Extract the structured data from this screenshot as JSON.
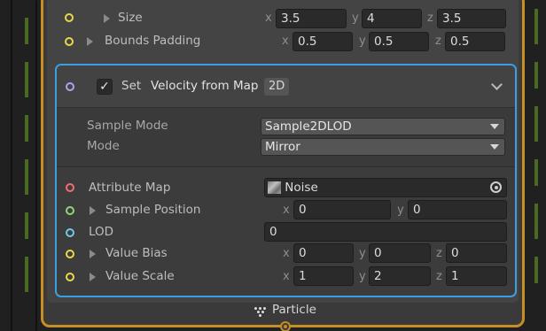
{
  "colors": {
    "selection_border": "#3aa0e6",
    "context_border": "#c58f25",
    "port_yellow": "#e8d84a",
    "port_purple": "#b89cf0",
    "port_red": "#ef6f6f",
    "port_green": "#8fd67a",
    "port_cyan": "#6fc9e8"
  },
  "previous_block": {
    "size": {
      "label": "Size",
      "x": "3.5",
      "y": "4",
      "z": "3.5"
    },
    "bounds_padding": {
      "label": "Bounds Padding",
      "x": "0.5",
      "y": "0.5",
      "z": "0.5"
    }
  },
  "block": {
    "enabled": true,
    "checkmark": "✓",
    "title_set": "Set",
    "title_name": "Velocity from Map",
    "badge": "2D",
    "settings": {
      "sample_mode": {
        "label": "Sample Mode",
        "value": "Sample2DLOD"
      },
      "mode": {
        "label": "Mode",
        "value": "Mirror"
      }
    },
    "properties": {
      "attribute_map": {
        "label": "Attribute Map",
        "value": "Noise"
      },
      "sample_position": {
        "label": "Sample Position",
        "x": "0",
        "y": "0"
      },
      "lod": {
        "label": "LOD",
        "value": "0"
      },
      "value_bias": {
        "label": "Value Bias",
        "x": "0",
        "y": "0",
        "z": "0"
      },
      "value_scale": {
        "label": "Value Scale",
        "x": "1",
        "y": "2",
        "z": "1"
      }
    }
  },
  "axes": {
    "x": "x",
    "y": "y",
    "z": "z"
  },
  "context_footer": {
    "label": "Particle",
    "icon": "particle-dots-icon"
  }
}
